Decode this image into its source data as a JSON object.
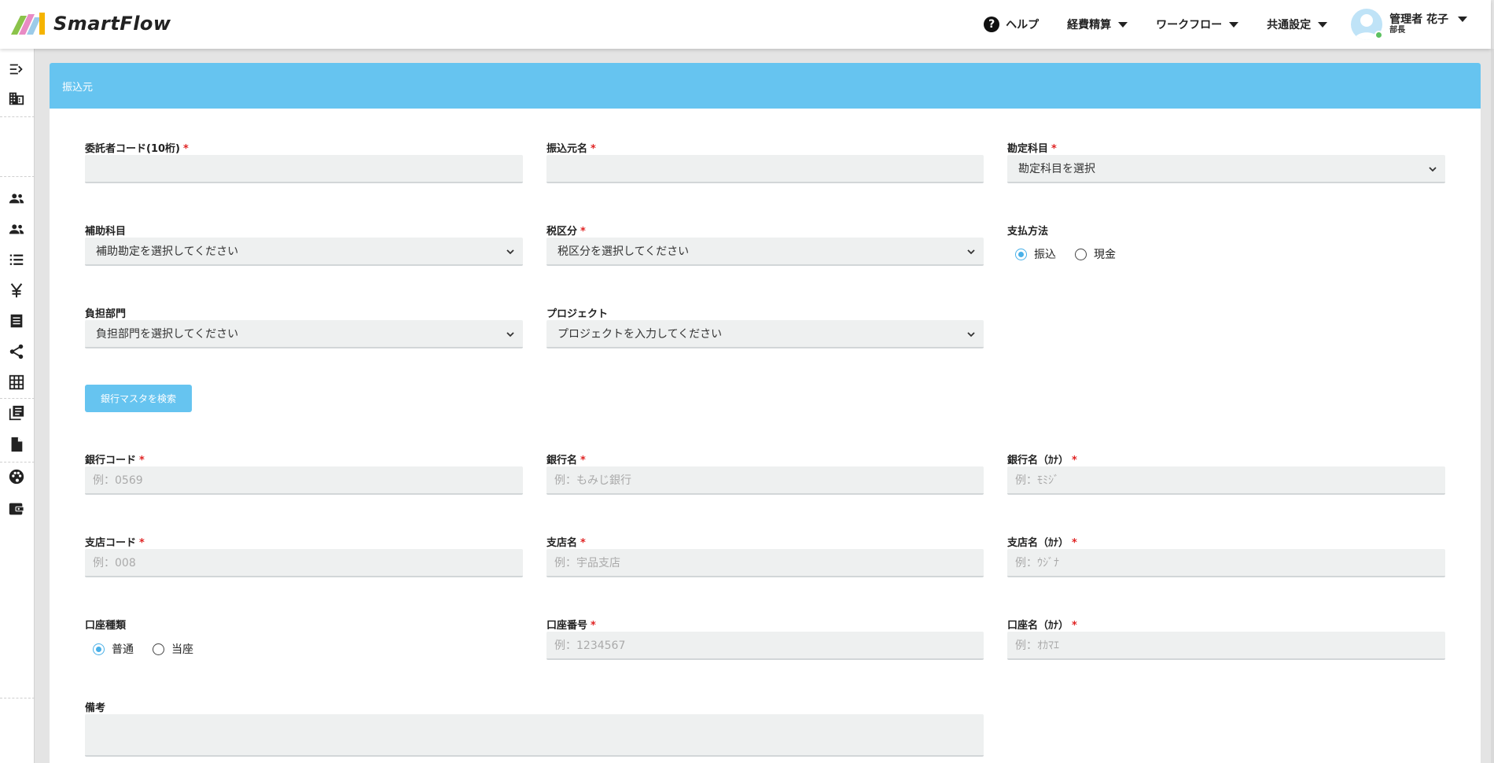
{
  "app": {
    "name": "SmartFlow",
    "brand_colors": [
      "#8bc34a",
      "#e88bc4",
      "#9ccbe9",
      "#f5b400"
    ]
  },
  "header": {
    "help": "ヘルプ",
    "menus": [
      "経費精算",
      "ワークフロー",
      "共通設定"
    ],
    "user": {
      "name": "管理者 花子",
      "role": "部長"
    }
  },
  "sidebar": {
    "icons": [
      "collapse-menu-icon",
      "building-icon",
      "users-icon",
      "users-group-icon",
      "list-icon",
      "yen-icon",
      "receipt-icon",
      "share-icon",
      "grid-icon",
      "library-icon",
      "document-icon",
      "palette-icon",
      "wallet-icon"
    ]
  },
  "card": {
    "title": "振込元"
  },
  "form": {
    "itaku_code": {
      "label": "委託者コード(10桁)",
      "value": ""
    },
    "furikomi_name": {
      "label": "振込元名",
      "value": ""
    },
    "kanjo": {
      "label": "勘定科目",
      "selected": "勘定科目を選択"
    },
    "hojo": {
      "label": "補助科目",
      "selected": "補助勘定を選択してください"
    },
    "zei": {
      "label": "税区分",
      "selected": "税区分を選択してください"
    },
    "shiharai": {
      "label": "支払方法",
      "options": [
        "振込",
        "現金"
      ],
      "selected": "振込"
    },
    "futan": {
      "label": "負担部門",
      "selected": "負担部門を選択してください"
    },
    "project": {
      "label": "プロジェクト",
      "selected": "プロジェクトを入力してください"
    },
    "search_button": "銀行マスタを検索",
    "bank_code": {
      "label": "銀行コード",
      "placeholder": "例：0569"
    },
    "bank_name": {
      "label": "銀行名",
      "placeholder": "例：もみじ銀行"
    },
    "bank_kana": {
      "label": "銀行名（ｶﾅ）",
      "placeholder": "例：ﾓﾐｼﾞ"
    },
    "branch_code": {
      "label": "支店コード",
      "placeholder": "例：008"
    },
    "branch_name": {
      "label": "支店名",
      "placeholder": "例：宇品支店"
    },
    "branch_kana": {
      "label": "支店名（ｶﾅ）",
      "placeholder": "例：ｳｼﾞﾅ"
    },
    "account_type": {
      "label": "口座種類",
      "options": [
        "普通",
        "当座"
      ],
      "selected": "普通"
    },
    "account_number": {
      "label": "口座番号",
      "placeholder": "例：1234567"
    },
    "account_kana": {
      "label": "口座名（ｶﾅ）",
      "placeholder": "例：ｵｶﾏｴ"
    },
    "remarks": {
      "label": "備考",
      "value": ""
    }
  },
  "required_mark": "*"
}
